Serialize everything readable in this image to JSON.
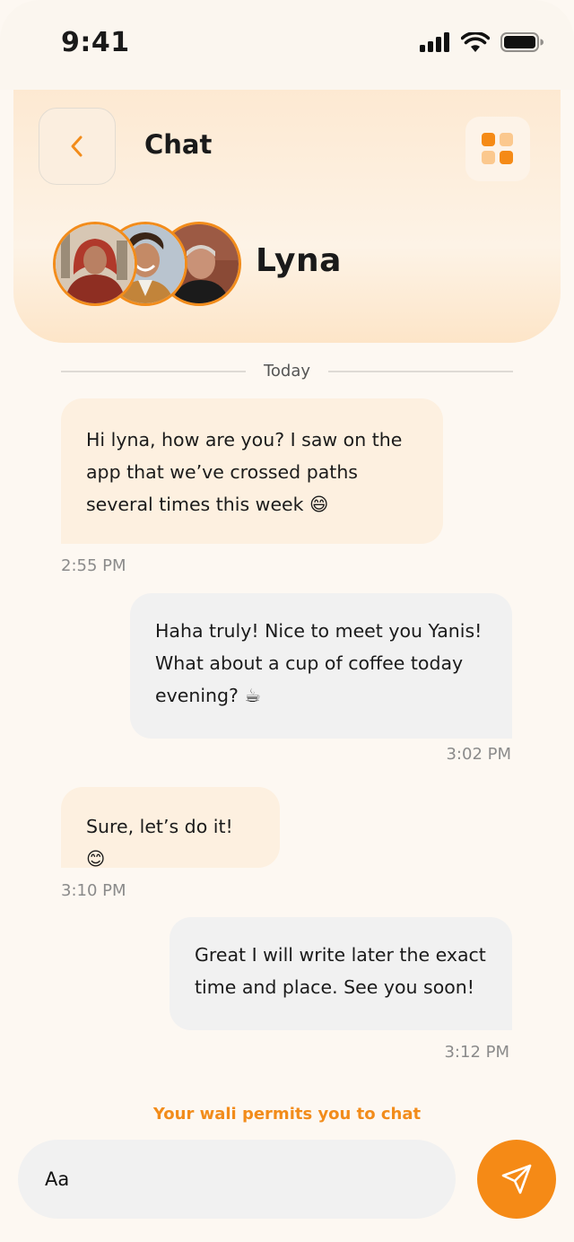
{
  "status_bar": {
    "time": "9:41"
  },
  "header": {
    "title": "Chat",
    "contact_name": "Lyna"
  },
  "divider": {
    "label": "Today"
  },
  "messages": [
    {
      "direction": "incoming",
      "lines": [
        "Hi lyna, how are you? I saw on the",
        "app that we’ve crossed paths",
        "several times this week 😄"
      ],
      "time": "2:55 PM"
    },
    {
      "direction": "outgoing",
      "lines": [
        "Haha truly! Nice to meet you Yanis!",
        "What about a cup of coffee today",
        "evening? ☕"
      ],
      "time": "3:02 PM"
    },
    {
      "direction": "incoming",
      "lines": [
        "Sure, let’s do it! 😊"
      ],
      "time": "3:10 PM"
    },
    {
      "direction": "outgoing",
      "lines": [
        "Great I will write later the exact",
        "time and place. See you soon!"
      ],
      "time": "3:12 PM"
    }
  ],
  "notice": "Your wali permits you to chat",
  "composer": {
    "placeholder": "Aa"
  },
  "icons": {
    "back": "chevron-left-icon",
    "menu": "grid-icon",
    "send": "send-icon",
    "signal": "signal-icon",
    "wifi": "wifi-icon",
    "battery": "battery-icon"
  },
  "colors": {
    "accent": "#f58a16",
    "incoming_bubble": "#fdf0e0",
    "outgoing_bubble": "#f1f1f1"
  }
}
